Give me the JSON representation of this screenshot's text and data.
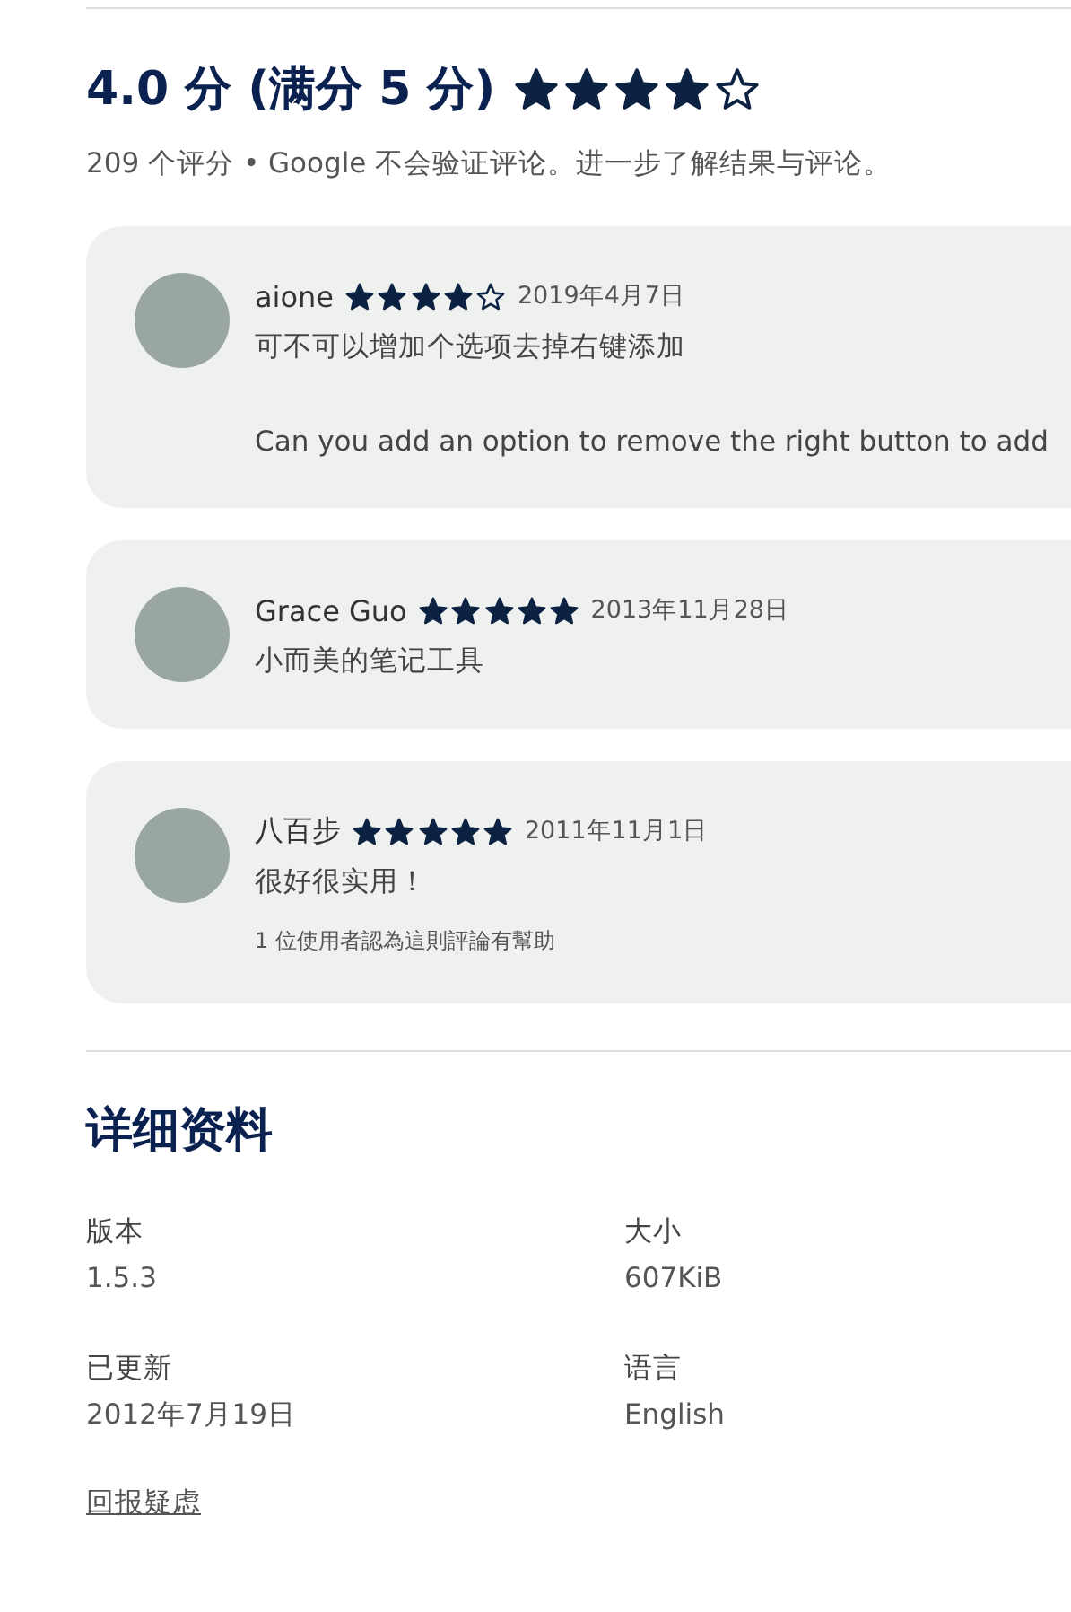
{
  "rating": {
    "title": "4.0 分 (满分 5 分)",
    "stars": 4,
    "summary": "209 个评分 • Google 不会验证评论。进一步了解结果与评论。"
  },
  "reviews": [
    {
      "name": "aione",
      "stars": 4,
      "date": "2019年4月7日",
      "paragraphs": [
        "可不可以增加个选项去掉右键添加",
        "Can you add an option to remove the right button to add"
      ]
    },
    {
      "name": "Grace Guo",
      "stars": 5,
      "date": "2013年11月28日",
      "paragraphs": [
        "小而美的笔记工具"
      ]
    },
    {
      "name": "八百步",
      "stars": 5,
      "date": "2011年11月1日",
      "paragraphs": [
        "很好很实用！"
      ],
      "helpful": "1 位使用者認為這則評論有幫助"
    }
  ],
  "details": {
    "title": "详细资料",
    "items": [
      {
        "label": "版本",
        "value": "1.5.3"
      },
      {
        "label": "大小",
        "value": "607KiB"
      },
      {
        "label": "已更新",
        "value": "2012年7月19日"
      },
      {
        "label": "语言",
        "value": "English"
      }
    ],
    "report_link": "回报疑虑"
  }
}
